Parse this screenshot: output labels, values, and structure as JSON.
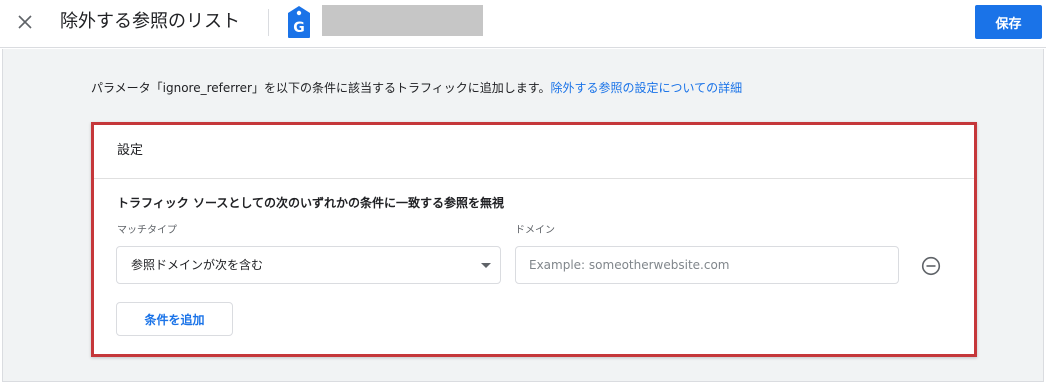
{
  "header": {
    "title": "除外する参照のリスト",
    "save_label": "保存",
    "tag_letter": "G"
  },
  "description": {
    "text": "パラメータ「ignore_referrer」を以下の条件に該当するトラフィックに追加します。",
    "link": "除外する参照の設定についての詳細"
  },
  "card": {
    "title": "設定",
    "rule_label": "トラフィック ソースとしての次のいずれかの条件に一致する参照を無視",
    "match_type_label": "マッチタイプ",
    "match_type_value": "参照ドメインが次を含む",
    "domain_label": "ドメイン",
    "domain_placeholder": "Example: someotherwebsite.com",
    "domain_value": "",
    "add_condition_label": "条件を追加"
  },
  "colors": {
    "accent": "#1a73e8",
    "highlight_border": "#c5373a",
    "background": "#f1f3f4"
  },
  "icons": {
    "close": "close-icon",
    "tag": "google-tag-icon",
    "dropdown": "caret-down-icon",
    "remove": "remove-circle-icon"
  }
}
